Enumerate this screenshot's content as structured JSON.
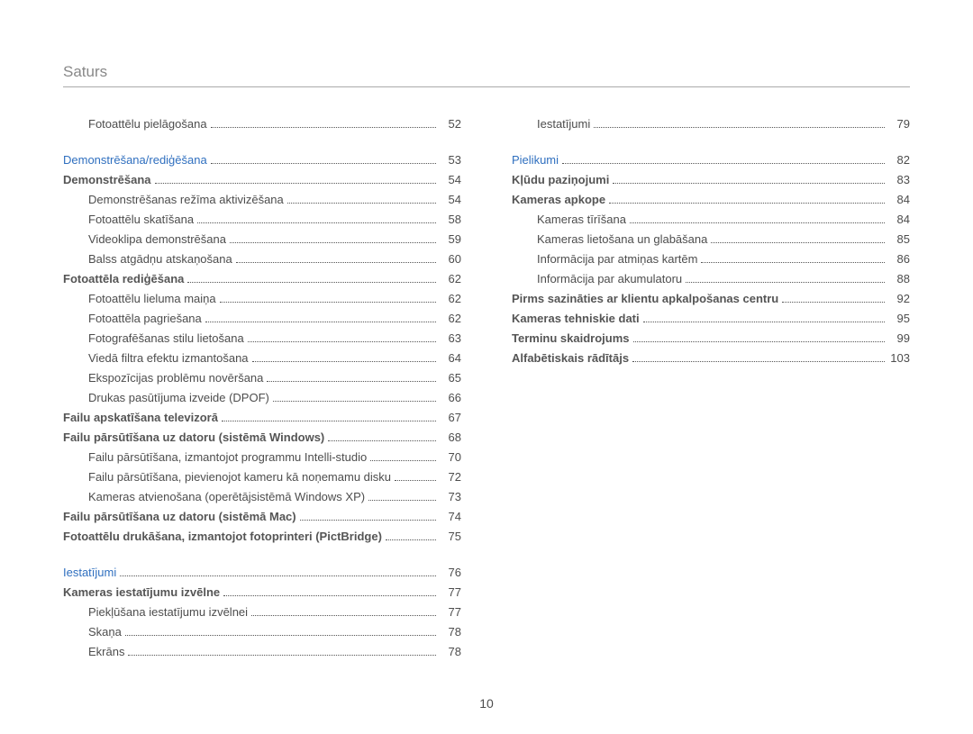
{
  "header": {
    "title": "Saturs"
  },
  "page_number": "10",
  "columns": {
    "left": [
      {
        "type": "sub",
        "label": "Fotoattēlu pielāgošana",
        "page": "52"
      },
      {
        "type": "spacer"
      },
      {
        "type": "section",
        "label": "Demonstrēšana/rediģēšana",
        "page": "53"
      },
      {
        "type": "bold",
        "label": "Demonstrēšana",
        "page": "54"
      },
      {
        "type": "sub",
        "label": "Demonstrēšanas režīma aktivizēšana",
        "page": "54"
      },
      {
        "type": "sub",
        "label": "Fotoattēlu skatīšana",
        "page": "58"
      },
      {
        "type": "sub",
        "label": "Videoklipa demonstrēšana",
        "page": "59"
      },
      {
        "type": "sub",
        "label": "Balss atgādņu atskaņošana",
        "page": "60"
      },
      {
        "type": "bold",
        "label": "Fotoattēla rediģēšana",
        "page": "62"
      },
      {
        "type": "sub",
        "label": "Fotoattēlu lieluma maiņa",
        "page": "62"
      },
      {
        "type": "sub",
        "label": "Fotoattēla pagriešana",
        "page": "62"
      },
      {
        "type": "sub",
        "label": "Fotografēšanas stilu lietošana",
        "page": "63"
      },
      {
        "type": "sub",
        "label": "Viedā filtra efektu izmantošana",
        "page": "64"
      },
      {
        "type": "sub",
        "label": "Ekspozīcijas problēmu novēršana",
        "page": "65"
      },
      {
        "type": "sub",
        "label": "Drukas pasūtījuma izveide (DPOF)",
        "page": "66"
      },
      {
        "type": "bold",
        "label": "Failu apskatīšana televizorā",
        "page": "67"
      },
      {
        "type": "bold",
        "label": "Failu pārsūtīšana uz datoru (sistēmā Windows)",
        "page": "68"
      },
      {
        "type": "sub",
        "label": "Failu pārsūtīšana, izmantojot programmu Intelli-studio",
        "page": "70"
      },
      {
        "type": "sub",
        "label": "Failu pārsūtīšana, pievienojot kameru kā noņemamu disku",
        "page": "72"
      },
      {
        "type": "sub",
        "label": "Kameras atvienošana (operētājsistēmā Windows XP)",
        "page": "73"
      },
      {
        "type": "bold",
        "label": "Failu pārsūtīšana uz datoru (sistēmā Mac)",
        "page": "74"
      },
      {
        "type": "bold",
        "label": "Fotoattēlu drukāšana, izmantojot fotoprinteri (PictBridge)",
        "page": "75",
        "wrap": true
      },
      {
        "type": "spacer"
      },
      {
        "type": "section",
        "label": "Iestatījumi",
        "page": "76"
      },
      {
        "type": "bold",
        "label": "Kameras iestatījumu izvēlne",
        "page": "77"
      },
      {
        "type": "sub",
        "label": "Piekļūšana iestatījumu izvēlnei",
        "page": "77"
      },
      {
        "type": "sub",
        "label": "Skaņa",
        "page": "78"
      },
      {
        "type": "sub",
        "label": "Ekrāns",
        "page": "78"
      }
    ],
    "right": [
      {
        "type": "sub",
        "label": "Iestatījumi",
        "page": "79"
      },
      {
        "type": "spacer"
      },
      {
        "type": "section",
        "label": "Pielikumi",
        "page": "82"
      },
      {
        "type": "bold",
        "label": "Kļūdu paziņojumi",
        "page": "83"
      },
      {
        "type": "bold",
        "label": "Kameras apkope",
        "page": "84"
      },
      {
        "type": "sub",
        "label": "Kameras tīrīšana",
        "page": "84"
      },
      {
        "type": "sub",
        "label": "Kameras lietošana un glabāšana",
        "page": "85"
      },
      {
        "type": "sub",
        "label": "Informācija par atmiņas kartēm",
        "page": "86"
      },
      {
        "type": "sub",
        "label": "Informācija par akumulatoru",
        "page": "88"
      },
      {
        "type": "bold",
        "label": "Pirms sazināties ar klientu apkalpošanas centru",
        "page": "92"
      },
      {
        "type": "bold",
        "label": "Kameras tehniskie dati",
        "page": "95"
      },
      {
        "type": "bold",
        "label": "Terminu skaidrojums",
        "page": "99"
      },
      {
        "type": "bold",
        "label": "Alfabētiskais rādītājs",
        "page": "103"
      }
    ]
  }
}
